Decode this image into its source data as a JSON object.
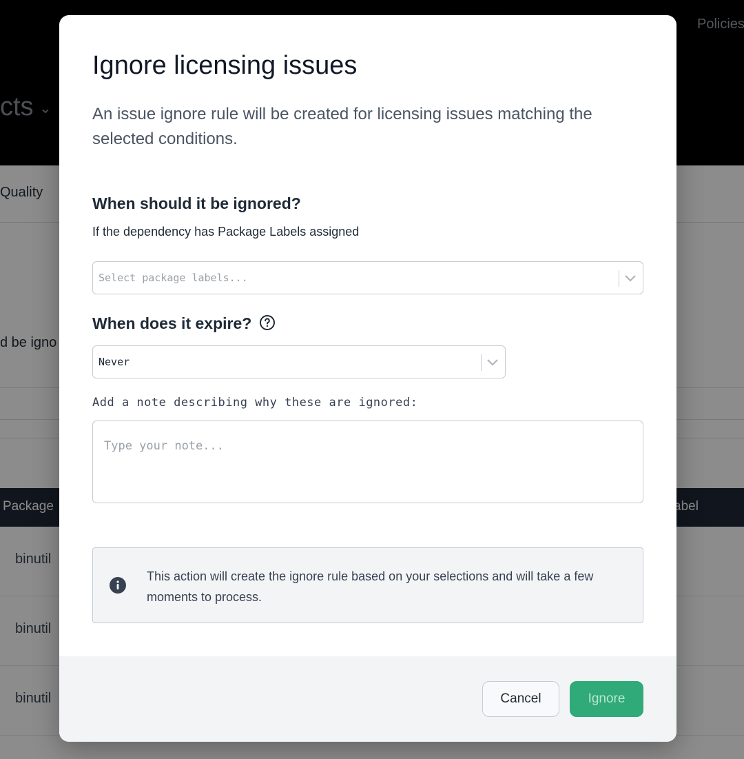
{
  "background": {
    "nav_link": "Policies",
    "page_title_partial": "cts",
    "tab_partial": "Quality",
    "text_partial": "d be igno",
    "table": {
      "col_left": "Package",
      "col_right": "abel",
      "rows": [
        "binutil",
        "binutil",
        "binutil"
      ]
    }
  },
  "modal": {
    "title": "Ignore licensing issues",
    "description": "An issue ignore rule will be created for licensing issues matching the selected conditions.",
    "when_ignored": {
      "heading": "When should it be ignored?",
      "sublabel": "If the dependency has Package Labels assigned",
      "select_placeholder": "Select package labels..."
    },
    "expire": {
      "heading": "When does it expire?",
      "help_icon": "question-circle-icon",
      "selected": "Never"
    },
    "note": {
      "label": "Add a note describing why these are ignored:",
      "placeholder": "Type your note...",
      "value": ""
    },
    "info": {
      "icon": "info-circle-icon",
      "text": "This action will create the ignore rule based on your selections and will take a few moments to process."
    },
    "buttons": {
      "cancel": "Cancel",
      "ignore": "Ignore"
    }
  },
  "colors": {
    "primary": "#2faa78",
    "text_dark": "#1f2a37",
    "muted": "#9aa0a8"
  }
}
